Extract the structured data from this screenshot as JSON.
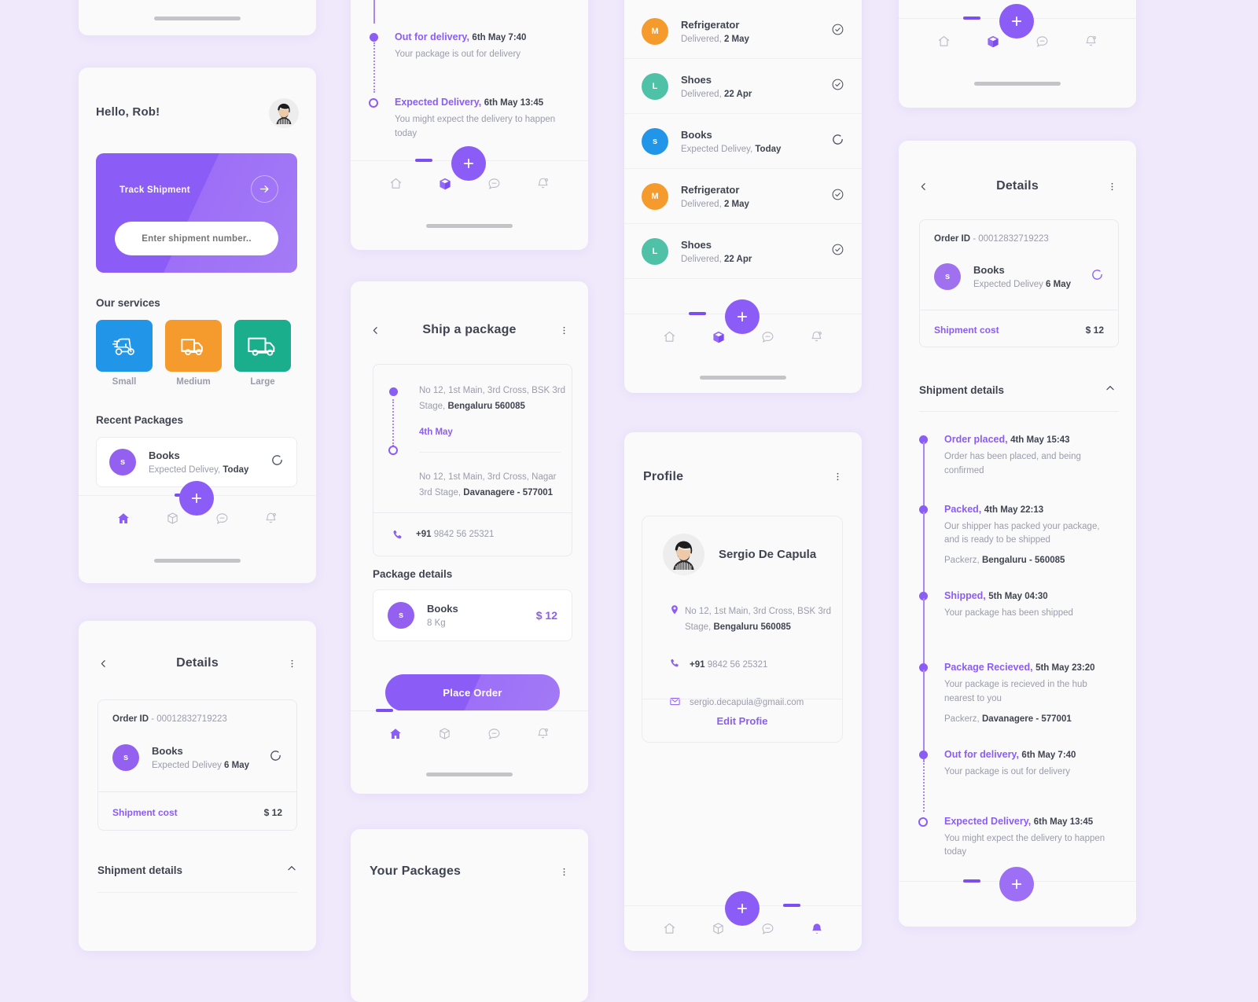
{
  "theme": {
    "bg": "#f0e9fc",
    "card": "#fafafa",
    "accent": "#8b5cf6",
    "text": "#3f4450",
    "muted": "#9a9cab",
    "svc_small": "#2196e8",
    "svc_medium": "#f59a2c",
    "svc_large": "#1aae8c"
  },
  "nav": {
    "items": [
      {
        "name": "home-icon",
        "label": "Home"
      },
      {
        "name": "package-icon",
        "label": "Packages"
      },
      {
        "name": "chat-icon",
        "label": "Messages"
      },
      {
        "name": "bell-icon",
        "label": "Notifications"
      }
    ],
    "fab_label": "+"
  },
  "home": {
    "greeting": "Hello, Rob!",
    "avatar_name": "user-avatar",
    "track": {
      "title": "Track Shipment",
      "input_value": "",
      "placeholder": "Enter shipment number..",
      "arrow_icon": "arrow-right-icon"
    },
    "services_title": "Our services",
    "services": [
      {
        "label": "Small",
        "icon": "scooter-icon",
        "color": "#2196e8"
      },
      {
        "label": "Medium",
        "icon": "truck-icon",
        "color": "#f59a2c"
      },
      {
        "label": "Large",
        "icon": "lorry-icon",
        "color": "#1aae8c"
      }
    ],
    "recent_title": "Recent Packages",
    "recent": {
      "initial": "s",
      "avatar_color": "#9460f0",
      "name": "Books",
      "status": "Expected Delivey, ",
      "status_strong": "Today",
      "status_icon": "in-progress-icon"
    }
  },
  "details": {
    "title": "Details",
    "back_icon": "chevron-left-icon",
    "menu_icon": "more-vertical-icon",
    "order_id_label": "Order ID",
    "order_id_sep": " - ",
    "order_id_value": "00012832719223",
    "item": {
      "initial": "s",
      "avatar_color": "#9460f0",
      "name": "Books",
      "status": "Expected Delivey ",
      "status_strong": "6 May",
      "status_icon": "in-progress-icon"
    },
    "cost_label": "Shipment cost",
    "cost_value": "$ 12",
    "shipment_details_label": "Shipment details",
    "collapse_icon": "chevron-up-icon"
  },
  "timeline": {
    "events": [
      {
        "title": "Order placed,",
        "time": "4th May 15:43",
        "desc": "Order has been placed, and being confirmed",
        "hub": "",
        "hub_strong": "",
        "state": "done"
      },
      {
        "title": "Packed,",
        "time": "4th May 22:13",
        "desc": "Our shipper has packed your package, and is ready to be shipped",
        "hub": "Packerz, ",
        "hub_strong": "Bengaluru - 560085",
        "state": "done"
      },
      {
        "title": "Shipped,",
        "time": "5th May 04:30",
        "desc": "Your package has been shipped",
        "hub": "",
        "hub_strong": "",
        "state": "done"
      },
      {
        "title": "Package Recieved,",
        "time": "5th May 23:20",
        "desc": "Your package is recieved in the hub nearest to you",
        "hub": "Packerz, ",
        "hub_strong": "Davanagere - 577001",
        "state": "done"
      },
      {
        "title": "Out for delivery,",
        "time": "6th May 7:40",
        "desc": "Your package is out for delivery",
        "hub": "",
        "hub_strong": "",
        "state": "current"
      },
      {
        "title": "Expected Delivery,",
        "time": "6th May 13:45",
        "desc": "You might expect the delivery to happen today",
        "hub": "",
        "hub_strong": "",
        "state": "pending"
      }
    ]
  },
  "timeline_top": {
    "hub_prefix": "Packerz, ",
    "hub_strong": "Davanagere - 577001",
    "events": [
      {
        "title": "Out for delivery,",
        "time": "6th May 7:40",
        "desc": "Your package is out for delivery",
        "state": "current"
      },
      {
        "title": "Expected Delivery,",
        "time": "6th May 13:45",
        "desc": "You might expect the delivery to happen today",
        "state": "pending"
      }
    ]
  },
  "ship": {
    "title": "Ship a package",
    "back_icon": "chevron-left-icon",
    "menu_icon": "more-vertical-icon",
    "from_line1": "No 12, 1st Main, 3rd Cross, BSK 3rd",
    "from_line2_pre": "Stage, ",
    "from_line2_strong": "Bengaluru 560085",
    "date": "4th May",
    "to_line1": "No 12, 1st Main, 3rd Cross, Nagar",
    "to_line2_pre": "3rd Stage, ",
    "to_line2_strong": "Davanagere - 577001",
    "phone_icon": "phone-icon",
    "phone_code": "+91",
    "phone_number": " 9842 56 25321",
    "package_details_title": "Package details",
    "package": {
      "initial": "s",
      "avatar_color": "#9460f0",
      "name": "Books",
      "weight": "8 Kg",
      "price": "$ 12"
    },
    "place_order_label": "Place Order"
  },
  "packages": {
    "title": "Your Packages",
    "menu_icon": "more-vertical-icon",
    "items": [
      {
        "initial": "M",
        "color": "#f59a2c",
        "name": "Refrigerator",
        "status": "Delivered, ",
        "status_strong": "2 May",
        "icon": "check-circle-icon"
      },
      {
        "initial": "L",
        "color": "#4fc1a6",
        "name": "Shoes",
        "status": "Delivered, ",
        "status_strong": "22 Apr",
        "icon": "check-circle-icon"
      },
      {
        "initial": "s",
        "color": "#2196e8",
        "name": "Books",
        "status": "Expected Delivey, ",
        "status_strong": "Today",
        "icon": "in-progress-icon"
      },
      {
        "initial": "M",
        "color": "#f59a2c",
        "name": "Refrigerator",
        "status": "Delivered, ",
        "status_strong": "2 May",
        "icon": "check-circle-icon"
      },
      {
        "initial": "L",
        "color": "#4fc1a6",
        "name": "Shoes",
        "status": "Delivered, ",
        "status_strong": "22 Apr",
        "icon": "check-circle-icon"
      }
    ]
  },
  "profile": {
    "title": "Profile",
    "menu_icon": "more-vertical-icon",
    "name": "Sergio De Capula",
    "avatar_name": "profile-avatar",
    "address_icon": "location-pin-icon",
    "address_line1": "No 12, 1st Main, 3rd Cross, BSK 3rd",
    "address_line2_pre": "Stage, ",
    "address_line2_strong": "Bengaluru 560085",
    "phone_icon": "phone-icon",
    "phone_code": "+91",
    "phone_number": " 9842 56 25321",
    "email_icon": "mail-icon",
    "email": "sergio.decapula@gmail.com",
    "edit_label": "Edit Profie"
  }
}
